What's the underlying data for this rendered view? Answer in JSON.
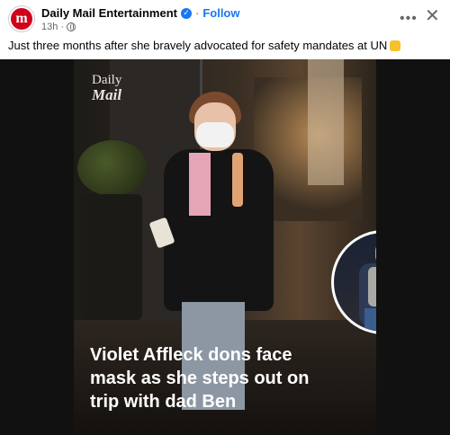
{
  "post": {
    "page_name": "Daily Mail Entertainment",
    "follow_label": "Follow",
    "separator": "·",
    "time": "13h",
    "meta_separator": "·",
    "avatar_letter": "m",
    "verified_mark": "✓",
    "caption": "Just three months after she bravely advocated for safety mandates at UN",
    "caption_emoji": "clap-emoji"
  },
  "icons": {
    "more": "more-options-icon",
    "close": "close-icon",
    "privacy": "globe-icon"
  },
  "image": {
    "logo_line1": "Daily",
    "logo_line2": "Mail",
    "headline_lines": [
      "Violet Affleck dons face",
      "mask as she steps out on",
      "trip with dad Ben"
    ]
  },
  "colors": {
    "accent": "#1877f2",
    "brand": "#d0021b",
    "secondary_text": "#65676b"
  }
}
